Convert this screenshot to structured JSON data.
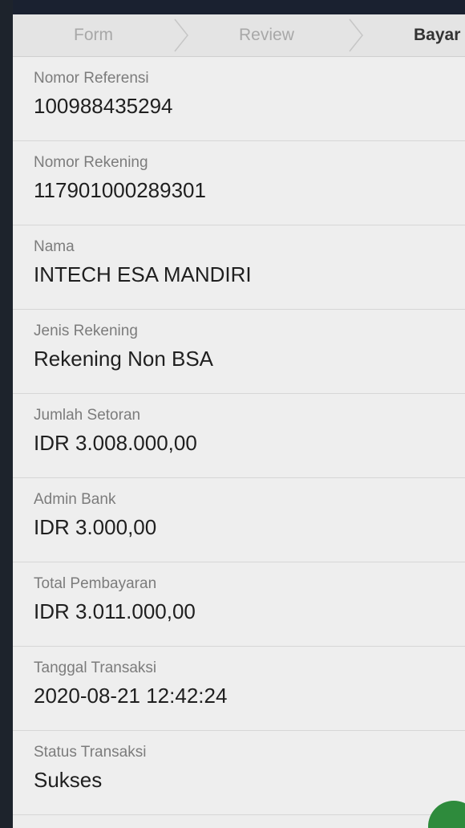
{
  "stepper": {
    "steps": [
      {
        "label": "Form",
        "state": "done"
      },
      {
        "label": "Review",
        "state": "done"
      },
      {
        "label": "Bayar",
        "state": "active"
      }
    ]
  },
  "details": [
    {
      "label": "Nomor Referensi",
      "value": "100988435294"
    },
    {
      "label": "Nomor Rekening",
      "value": "117901000289301"
    },
    {
      "label": "Nama",
      "value": "INTECH ESA MANDIRI"
    },
    {
      "label": "Jenis Rekening",
      "value": "Rekening Non BSA"
    },
    {
      "label": "Jumlah Setoran",
      "value": "IDR 3.008.000,00"
    },
    {
      "label": "Admin Bank",
      "value": "IDR 3.000,00"
    },
    {
      "label": "Total Pembayaran",
      "value": "IDR 3.011.000,00"
    },
    {
      "label": "Tanggal Transaksi",
      "value": "2020-08-21 12:42:24"
    },
    {
      "label": "Status Transaksi",
      "value": "Sukses"
    }
  ],
  "colors": {
    "accent": "#2e8b3c",
    "background": "#ededed"
  }
}
